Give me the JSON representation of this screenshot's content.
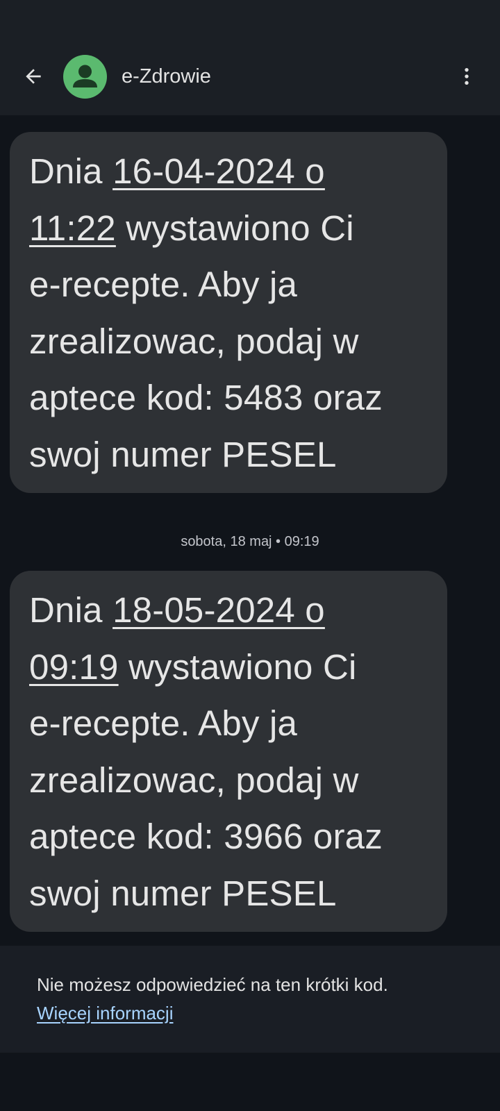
{
  "header": {
    "back_icon": "arrow-back-icon",
    "contact_name": "e-Zdrowie",
    "avatar_icon": "person-icon",
    "avatar_color": "#5bba6f",
    "more_icon": "more-vert-icon"
  },
  "messages": [
    {
      "lines": [
        {
          "pre": "Dnia ",
          "link": "16-04-2024 o",
          "post": ""
        },
        {
          "pre": "",
          "link": "11:22",
          "post": " wystawiono Ci"
        },
        {
          "pre": "e-recepte. Aby ja",
          "link": "",
          "post": ""
        },
        {
          "pre": "zrealizowac, podaj w",
          "link": "",
          "post": ""
        },
        {
          "pre": "aptece kod: 5483 oraz",
          "link": "",
          "post": ""
        },
        {
          "pre": "swoj numer PESEL",
          "link": "",
          "post": ""
        }
      ]
    },
    {
      "lines": [
        {
          "pre": "Dnia ",
          "link": "18-05-2024 o",
          "post": ""
        },
        {
          "pre": "",
          "link": "09:19",
          "post": " wystawiono Ci"
        },
        {
          "pre": "e-recepte. Aby ja",
          "link": "",
          "post": ""
        },
        {
          "pre": "zrealizowac, podaj w",
          "link": "",
          "post": ""
        },
        {
          "pre": "aptece kod: 3966 oraz",
          "link": "",
          "post": ""
        },
        {
          "pre": "swoj numer PESEL",
          "link": "",
          "post": ""
        }
      ]
    }
  ],
  "timestamp": "sobota, 18 maj • 09:19",
  "footer": {
    "info_text": "Nie możesz odpowiedzieć na ten krótki kod.",
    "info_link": "Więcej informacji",
    "link_color": "#a8d4ff"
  }
}
